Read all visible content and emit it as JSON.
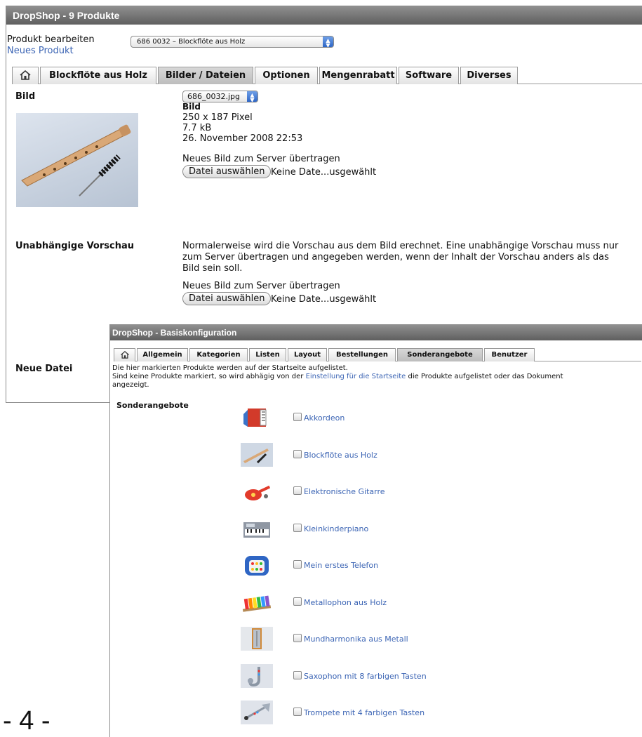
{
  "window1": {
    "title": "DropShop - 9 Produkte",
    "edit_label": "Produkt bearbeiten",
    "product_select": "686 0032 – Blockflöte aus Holz",
    "new_product": "Neues Produkt",
    "tabs": [
      "Blockflöte aus Holz",
      "Bilder / Dateien",
      "Optionen",
      "Mengenrabatt",
      "Software",
      "Diverses"
    ],
    "active_tab": "Bilder / Dateien",
    "bild": {
      "label": "Bild",
      "file_select": "686_0032.jpg",
      "info_title": "Bild",
      "dimensions": "250 x 187 Pixel",
      "size": "7.7 kB",
      "date": "26. November 2008 22:53",
      "upload_label": "Neues Bild zum Server übertragen",
      "choose_button": "Datei auswählen",
      "no_file": "Keine Date...usgewählt"
    },
    "preview": {
      "label": "Unabhängige Vorschau",
      "desc_line1": "Normalerweise wird die Vorschau aus dem Bild erechnet. Eine unabhängige Vorschau muss nur",
      "desc_line2": "zum Server übertragen und angegeben werden, wenn der Inhalt der Vorschau anders als das",
      "desc_line3": "Bild sein soll.",
      "upload_label": "Neues Bild zum Server übertragen",
      "choose_button": "Datei auswählen",
      "no_file": "Keine Date...usgewählt"
    },
    "new_file_label": "Neue Datei"
  },
  "window2": {
    "title": "DropShop - Basiskonfiguration",
    "tabs": [
      "Allgemein",
      "Kategorien",
      "Listen",
      "Layout",
      "Bestellungen",
      "Sonderangebote",
      "Benutzer"
    ],
    "active_tab": "Sonderangebote",
    "desc_line1": "Die hier markierten Produkte werden auf der Startseite aufgelistet.",
    "desc_line2_pre": "Sind keine Produkte markiert, so wird abhägig von der ",
    "desc_line2_link": "Einstellung für die Startseite",
    "desc_line2_post": " die Produkte aufgelistet oder das Dokument",
    "desc_line3": "angezeigt.",
    "section_label": "Sonderangebote",
    "products": [
      {
        "name": "Akkordeon",
        "icon": "accordion-icon",
        "checked": false
      },
      {
        "name": "Blockflöte aus Holz",
        "icon": "recorder-icon",
        "checked": false
      },
      {
        "name": "Elektronische Gitarre",
        "icon": "guitar-icon",
        "checked": false
      },
      {
        "name": "Kleinkinderpiano",
        "icon": "piano-icon",
        "checked": false
      },
      {
        "name": "Mein erstes Telefon",
        "icon": "telephone-icon",
        "checked": false
      },
      {
        "name": "Metallophon aus Holz",
        "icon": "metallophone-icon",
        "checked": false
      },
      {
        "name": "Mundharmonika aus Metall",
        "icon": "harmonica-icon",
        "checked": false
      },
      {
        "name": "Saxophon mit 8 farbigen Tasten",
        "icon": "saxophone-icon",
        "checked": false
      },
      {
        "name": "Trompete mit 4 farbigen Tasten",
        "icon": "trumpet-icon",
        "checked": false
      }
    ]
  },
  "page_number": "- 4 -",
  "colors": {
    "link": "#3b64b4",
    "titlebar": "#6f6f6f",
    "active_tab": "#c8c8c8"
  }
}
